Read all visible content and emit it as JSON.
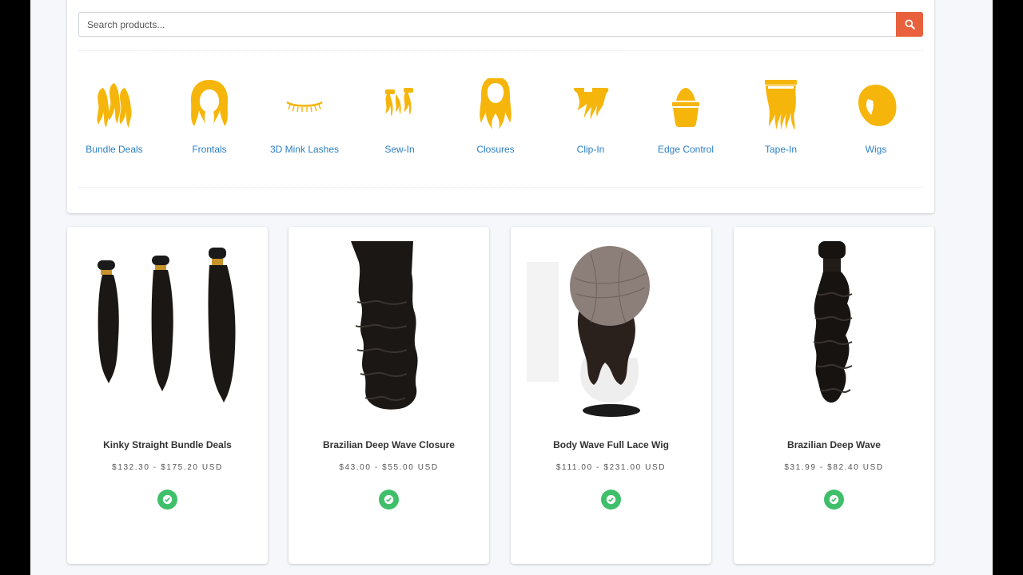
{
  "search": {
    "placeholder": "Search products..."
  },
  "categories": [
    {
      "label": "Bundle Deals",
      "icon": "bundle-deals-icon"
    },
    {
      "label": "Frontals",
      "icon": "frontal-icon"
    },
    {
      "label": "3D Mink Lashes",
      "icon": "lashes-icon"
    },
    {
      "label": "Sew-In",
      "icon": "sew-in-icon"
    },
    {
      "label": "Closures",
      "icon": "closure-icon"
    },
    {
      "label": "Clip-In",
      "icon": "clip-in-icon"
    },
    {
      "label": "Edge Control",
      "icon": "edge-control-icon"
    },
    {
      "label": "Tape-In",
      "icon": "tape-in-icon"
    },
    {
      "label": "Wigs",
      "icon": "wig-icon"
    }
  ],
  "products": [
    {
      "title": "Kinky Straight Bundle Deals",
      "price": "$132.30 - $175.20 USD",
      "image": "three-straight-bundles"
    },
    {
      "title": "Brazilian Deep Wave Closure",
      "price": "$43.00 - $55.00 USD",
      "image": "deep-wave-closure"
    },
    {
      "title": "Body Wave Full Lace Wig",
      "price": "$111.00 - $231.00 USD",
      "image": "lace-wig-on-mannequin"
    },
    {
      "title": "Brazilian Deep Wave",
      "price": "$31.99 - $82.40 USD",
      "image": "deep-wave-bundle"
    }
  ],
  "colors": {
    "accent": "#e8603c",
    "icon_gold": "#f5b50a",
    "link": "#2b7fc4",
    "available": "#3fbf6a"
  }
}
